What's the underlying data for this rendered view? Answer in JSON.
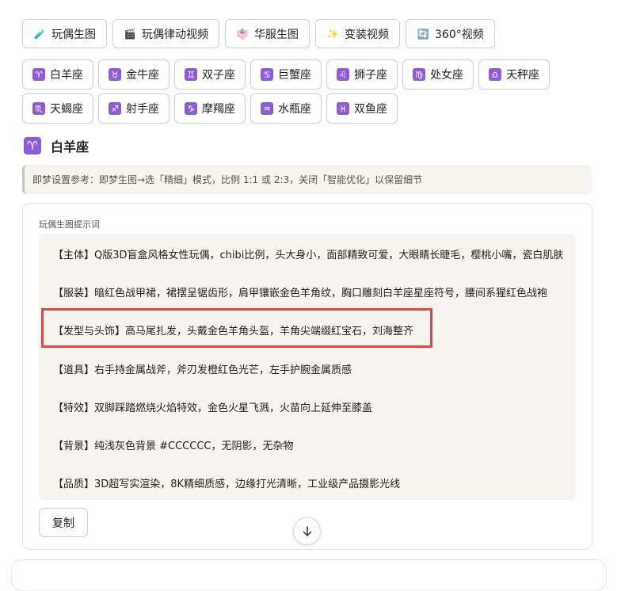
{
  "tabs": [
    {
      "label": "玩偶生图",
      "icon": "flask-icon",
      "glyph": "🧪"
    },
    {
      "label": "玩偶律动视频",
      "icon": "clapperboard-icon",
      "glyph": "🎬"
    },
    {
      "label": "华服生图",
      "icon": "hanfu-icon",
      "glyph": "👘"
    },
    {
      "label": "变装视频",
      "icon": "sparkles-icon",
      "glyph": "✨"
    },
    {
      "label": "360°视频",
      "icon": "rotate-icon",
      "glyph": "🔄"
    }
  ],
  "zodiac_row1": [
    {
      "label": "白羊座",
      "symbol": "♈",
      "icon": "aries-icon"
    },
    {
      "label": "金牛座",
      "symbol": "♉",
      "icon": "taurus-icon"
    },
    {
      "label": "双子座",
      "symbol": "♊",
      "icon": "gemini-icon"
    },
    {
      "label": "巨蟹座",
      "symbol": "♋",
      "icon": "cancer-icon"
    },
    {
      "label": "狮子座",
      "symbol": "♌",
      "icon": "leo-icon"
    },
    {
      "label": "处女座",
      "symbol": "♍",
      "icon": "virgo-icon"
    },
    {
      "label": "天秤座",
      "symbol": "♎",
      "icon": "libra-icon"
    }
  ],
  "zodiac_row2": [
    {
      "label": "天蝎座",
      "symbol": "♏",
      "icon": "scorpio-icon"
    },
    {
      "label": "射手座",
      "symbol": "♐",
      "icon": "sagittarius-icon"
    },
    {
      "label": "摩羯座",
      "symbol": "♑",
      "icon": "capricorn-icon"
    },
    {
      "label": "水瓶座",
      "symbol": "♒",
      "icon": "aquarius-icon"
    },
    {
      "label": "双鱼座",
      "symbol": "♓",
      "icon": "pisces-icon"
    }
  ],
  "selected": {
    "symbol": "♈",
    "label": "白羊座"
  },
  "tip": "即梦设置参考：即梦生图→选「精细」模式，比例 1:1 或 2:3，关闭「智能优化」以保留细节",
  "card": {
    "label": "玩偶生图提示词",
    "lines": [
      "【主体】Q版3D盲盒风格女性玩偶，chibi比例，头大身小，面部精致可爱，大眼睛长睫毛，樱桃小嘴，瓷白肌肤",
      "【服装】暗红色战甲裙，裙摆呈锯齿形，肩甲镶嵌金色羊角纹，胸口雕刻白羊座星座符号，腰间系猩红色战袍",
      "【发型与头饰】高马尾扎发，头戴金色羊角头盔，羊角尖端缀红宝石，刘海整齐",
      "【道具】右手持金属战斧，斧刃发橙红色光芒，左手护腕金属质感",
      "【特效】双脚踩踏燃烧火焰特效，金色火星飞溅，火苗向上延伸至膝盖",
      "【背景】纯浅灰色背景 #CCCCCC，无阴影，无杂物",
      "【品质】3D超写实渲染，8K精细质感，边缘打光清晰，工业级产品摄影光线"
    ],
    "copy_label": "复制"
  },
  "colors": {
    "zodiac_badge": "#8e5cd9",
    "highlight": "#e04848",
    "panel_bg": "#f5f4ef"
  }
}
